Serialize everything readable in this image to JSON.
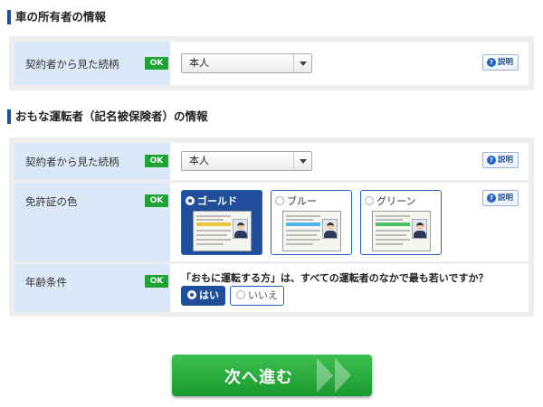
{
  "owner_section": {
    "title": "車の所有者の情報",
    "relation": {
      "label": "契約者から見た続柄",
      "badge": "OK",
      "value": "本人",
      "help": "説明"
    }
  },
  "driver_section": {
    "title": "おもな運転者（記名被保険者）の情報",
    "relation": {
      "label": "契約者から見た続柄",
      "badge": "OK",
      "value": "本人",
      "help": "説明"
    },
    "license": {
      "label": "免許証の色",
      "badge": "OK",
      "help": "説明",
      "options": [
        {
          "label": "ゴールド",
          "selected": true,
          "band_color": "#e8c43a"
        },
        {
          "label": "ブルー",
          "selected": false,
          "band_color": "#4fb4e8"
        },
        {
          "label": "グリーン",
          "selected": false,
          "band_color": "#4cc16a"
        }
      ]
    },
    "age": {
      "label": "年齢条件",
      "badge": "OK",
      "question": "「おもに運転する方」は、すべての運転者のなかで最も若いですか？",
      "yes": "はい",
      "no": "いいえ",
      "selected": "はい"
    }
  },
  "next_button": {
    "label": "次へ進む"
  },
  "colors": {
    "accent": "#1f4f9a",
    "ok_green": "#1fa335",
    "label_bg": "#dbe8f7",
    "next_green": "#22a637"
  }
}
